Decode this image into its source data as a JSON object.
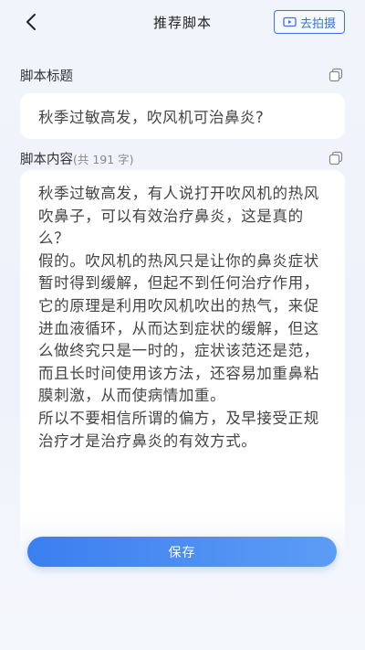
{
  "header": {
    "title": "推荐脚本",
    "shoot_label": "去拍摄",
    "back_icon": "chevron-left-icon",
    "camera_icon": "video-camera-icon"
  },
  "script_title": {
    "label": "脚本标题",
    "value": "秋季过敏高发，吹风机可治鼻炎?",
    "copy_icon": "copy-icon"
  },
  "script_content": {
    "label": "脚本内容",
    "count": "(共 191 字)",
    "copy_icon": "copy-icon",
    "text": "秋季过敏高发，有人说打开吹风机的热风吹鼻子，可以有效治疗鼻炎，这是真的么？\n假的。吹风机的热风只是让你的鼻炎症状暂时得到缓解，但起不到任何治疗作用，它的原理是利用吹风机吹出的热气，来促进血液循环，从而达到症状的缓解，但这么做终究只是一时的，症状该范还是范，而且长时间使用该方法，还容易加重鼻粘膜刺激，从而使病情加重。\n所以不要相信所谓的偏方，及早接受正规治疗才是治疗鼻炎的有效方式。"
  },
  "footer": {
    "save_label": "保存"
  },
  "colors": {
    "accent": "#3b73e6",
    "background": "#eef2fa",
    "card": "#ffffff"
  }
}
